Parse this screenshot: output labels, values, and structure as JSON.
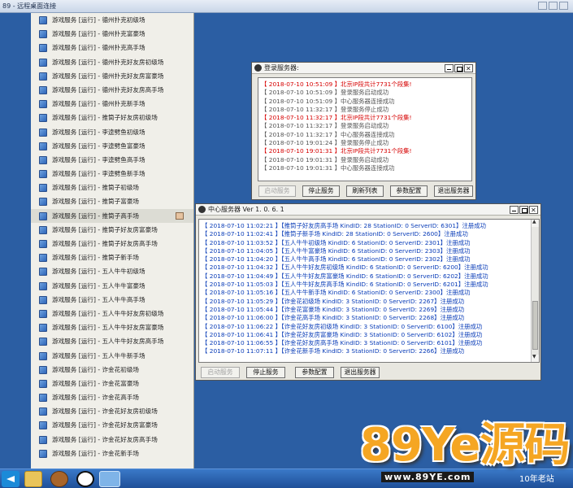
{
  "remote_title": "89 - 远程桌面连接",
  "colors": {
    "desktop": "#2b5ea3",
    "log_blue": "#0a3db8",
    "log_red": "#d60000",
    "watermark": "#f5a623"
  },
  "menu": {
    "items": [
      "游戏服务 [运行] - 德州扑克初级场",
      "游戏服务 [运行] - 德州扑克富豪场",
      "游戏服务 [运行] - 德州扑克高手场",
      "游戏服务 [运行] - 德州扑克好友房初级场",
      "游戏服务 [运行] - 德州扑克好友房富豪场",
      "游戏服务 [运行] - 德州扑克好友房高手场",
      "游戏服务 [运行] - 德州扑克新手场",
      "游戏服务 [运行] - 推筒子好友房初级场",
      "游戏服务 [运行] - 李逵劈鱼初级场",
      "游戏服务 [运行] - 李逵劈鱼富豪场",
      "游戏服务 [运行] - 李逵劈鱼高手场",
      "游戏服务 [运行] - 李逵劈鱼新手场",
      "游戏服务 [运行] - 推筒子初级场",
      "游戏服务 [运行] - 推筒子富豪场",
      "游戏服务 [运行] - 推筒子高手场",
      "游戏服务 [运行] - 推筒子好友房富豪场",
      "游戏服务 [运行] - 推筒子好友房高手场",
      "游戏服务 [运行] - 推筒子新手场",
      "游戏服务 [运行] - 五人牛牛初级场",
      "游戏服务 [运行] - 五人牛牛富豪场",
      "游戏服务 [运行] - 五人牛牛高手场",
      "游戏服务 [运行] - 五人牛牛好友房初级场",
      "游戏服务 [运行] - 五人牛牛好友房富豪场",
      "游戏服务 [运行] - 五人牛牛好友房高手场",
      "游戏服务 [运行] - 五人牛牛新手场",
      "游戏服务 [运行] - 诈金花初级场",
      "游戏服务 [运行] - 诈金花富豪场",
      "游戏服务 [运行] - 诈金花高手场",
      "游戏服务 [运行] - 诈金花好友房初级场",
      "游戏服务 [运行] - 诈金花好友房富豪场",
      "游戏服务 [运行] - 诈金花好友房高手场",
      "游戏服务 [运行] - 诈金花新手场"
    ],
    "selected_index": 14
  },
  "login_window": {
    "title": "登录服务器:",
    "logs": [
      {
        "text": "【 2018-07-10 10:51:09 】北京IP段共计7731个段集!",
        "level": "red"
      },
      {
        "text": "【 2018-07-10 10:51:09 】登录服务启动成功",
        "level": "gray"
      },
      {
        "text": "【 2018-07-10 10:51:09 】中心服务器连接成功",
        "level": "gray"
      },
      {
        "text": "【 2018-07-10 11:32:17 】登录服务停止成功",
        "level": "gray"
      },
      {
        "text": "【 2018-07-10 11:32:17 】北京IP段共计7731个段集!",
        "level": "red"
      },
      {
        "text": "【 2018-07-10 11:32:17 】登录服务启动成功",
        "level": "gray"
      },
      {
        "text": "【 2018-07-10 11:32:17 】中心服务器连接成功",
        "level": "gray"
      },
      {
        "text": "【 2018-07-10 19:01:24 】登录服务停止成功",
        "level": "gray"
      },
      {
        "text": "【 2018-07-10 19:01:31 】北京IP段共计7731个段集!",
        "level": "red"
      },
      {
        "text": "【 2018-07-10 19:01:31 】登录服务启动成功",
        "level": "gray"
      },
      {
        "text": "【 2018-07-10 19:01:31 】中心服务器连接成功",
        "level": "gray"
      }
    ],
    "buttons": {
      "start": "启动服务",
      "stop": "停止服务",
      "refresh": "刷新列表",
      "config": "参数配置",
      "exit": "退出服务器"
    }
  },
  "center_window": {
    "title": "中心服务器 Ver 1. 0. 6. 1",
    "logs": [
      "【 2018-07-10 11:02:21 】【推筒子好友房高手场  KindID: 28 StationID: 0  ServerID: 6301】注册成功",
      "【 2018-07-10 11:02:41 】【推筒子新手场  KindID: 28 StationID: 0  ServerID: 2600】注册成功",
      "【 2018-07-10 11:03:52 】【五人牛牛初级场  KindID: 6 StationID: 0  ServerID: 2301】注册成功",
      "【 2018-07-10 11:04:05 】【五人牛牛富豪场  KindID: 6 StationID: 0  ServerID: 2303】注册成功",
      "【 2018-07-10 11:04:20 】【五人牛牛高手场  KindID: 6 StationID: 0  ServerID: 2302】注册成功",
      "【 2018-07-10 11:04:32 】【五人牛牛好友房初级场  KindID: 6 StationID: 0  ServerID: 6200】注册成功",
      "【 2018-07-10 11:04:49 】【五人牛牛好友房富豪场  KindID: 6 StationID: 0  ServerID: 6202】注册成功",
      "【 2018-07-10 11:05:03 】【五人牛牛好友房高手场  KindID: 6 StationID: 0  ServerID: 6201】注册成功",
      "【 2018-07-10 11:05:16 】【五人牛牛新手场  KindID: 6 StationID: 0  ServerID: 2300】注册成功",
      "【 2018-07-10 11:05:29 】【诈金花初级场  KindID: 3 StationID: 0  ServerID: 2267】注册成功",
      "【 2018-07-10 11:05:44 】【诈金花富豪场  KindID: 3 StationID: 0  ServerID: 2269】注册成功",
      "【 2018-07-10 11:06:00 】【诈金花高手场  KindID: 3 StationID: 0  ServerID: 2268】注册成功",
      "【 2018-07-10 11:06:22 】【诈金花好友房初级场  KindID: 3 StationID: 0  ServerID: 6100】注册成功",
      "【 2018-07-10 11:06:41 】【诈金花好友房富豪场  KindID: 3 StationID: 0  ServerID: 6102】注册成功",
      "【 2018-07-10 11:06:55 】【诈金花好友房高手场  KindID: 3 StationID: 0  ServerID: 6101】注册成功",
      "【 2018-07-10 11:07:11 】【诈金花新手场  KindID: 3 StationID: 0  ServerID: 2266】注册成功"
    ],
    "buttons": {
      "start": "启动服务",
      "stop": "停止服务",
      "config": "参数配置",
      "exit": "退出服务器"
    }
  },
  "watermark": {
    "logo": "89Ye源码",
    "url": "www.89YE.com",
    "tag": "10年老站"
  }
}
